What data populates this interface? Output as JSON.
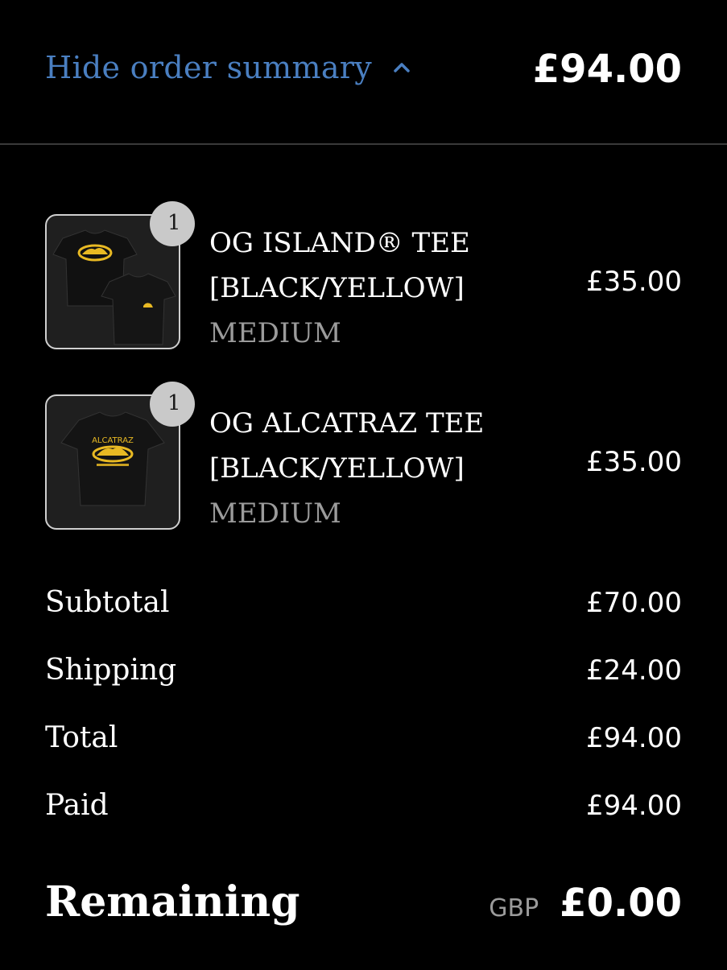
{
  "header": {
    "toggle_label": "Hide order summary",
    "chevron_icon": "chevron-up-icon",
    "total": "£94.00"
  },
  "items": [
    {
      "quantity": "1",
      "name_line1": "OG ISLAND® TEE",
      "name_line2": "[BLACK/YELLOW]",
      "variant": "MEDIUM",
      "price": "£35.00"
    },
    {
      "quantity": "1",
      "name_line1": "OG ALCATRAZ TEE",
      "name_line2": "[BLACK/YELLOW]",
      "variant": "MEDIUM",
      "price": "£35.00"
    }
  ],
  "summary": {
    "subtotal_label": "Subtotal",
    "subtotal_value": "£70.00",
    "shipping_label": "Shipping",
    "shipping_value": "£24.00",
    "total_label": "Total",
    "total_value": "£94.00",
    "paid_label": "Paid",
    "paid_value": "£94.00",
    "remaining_label": "Remaining",
    "remaining_currency": "GBP",
    "remaining_value": "£0.00"
  },
  "colors": {
    "background": "#000000",
    "link": "#4a7fc1",
    "muted": "#9b9b9b",
    "product_yellow": "#e8b923"
  }
}
